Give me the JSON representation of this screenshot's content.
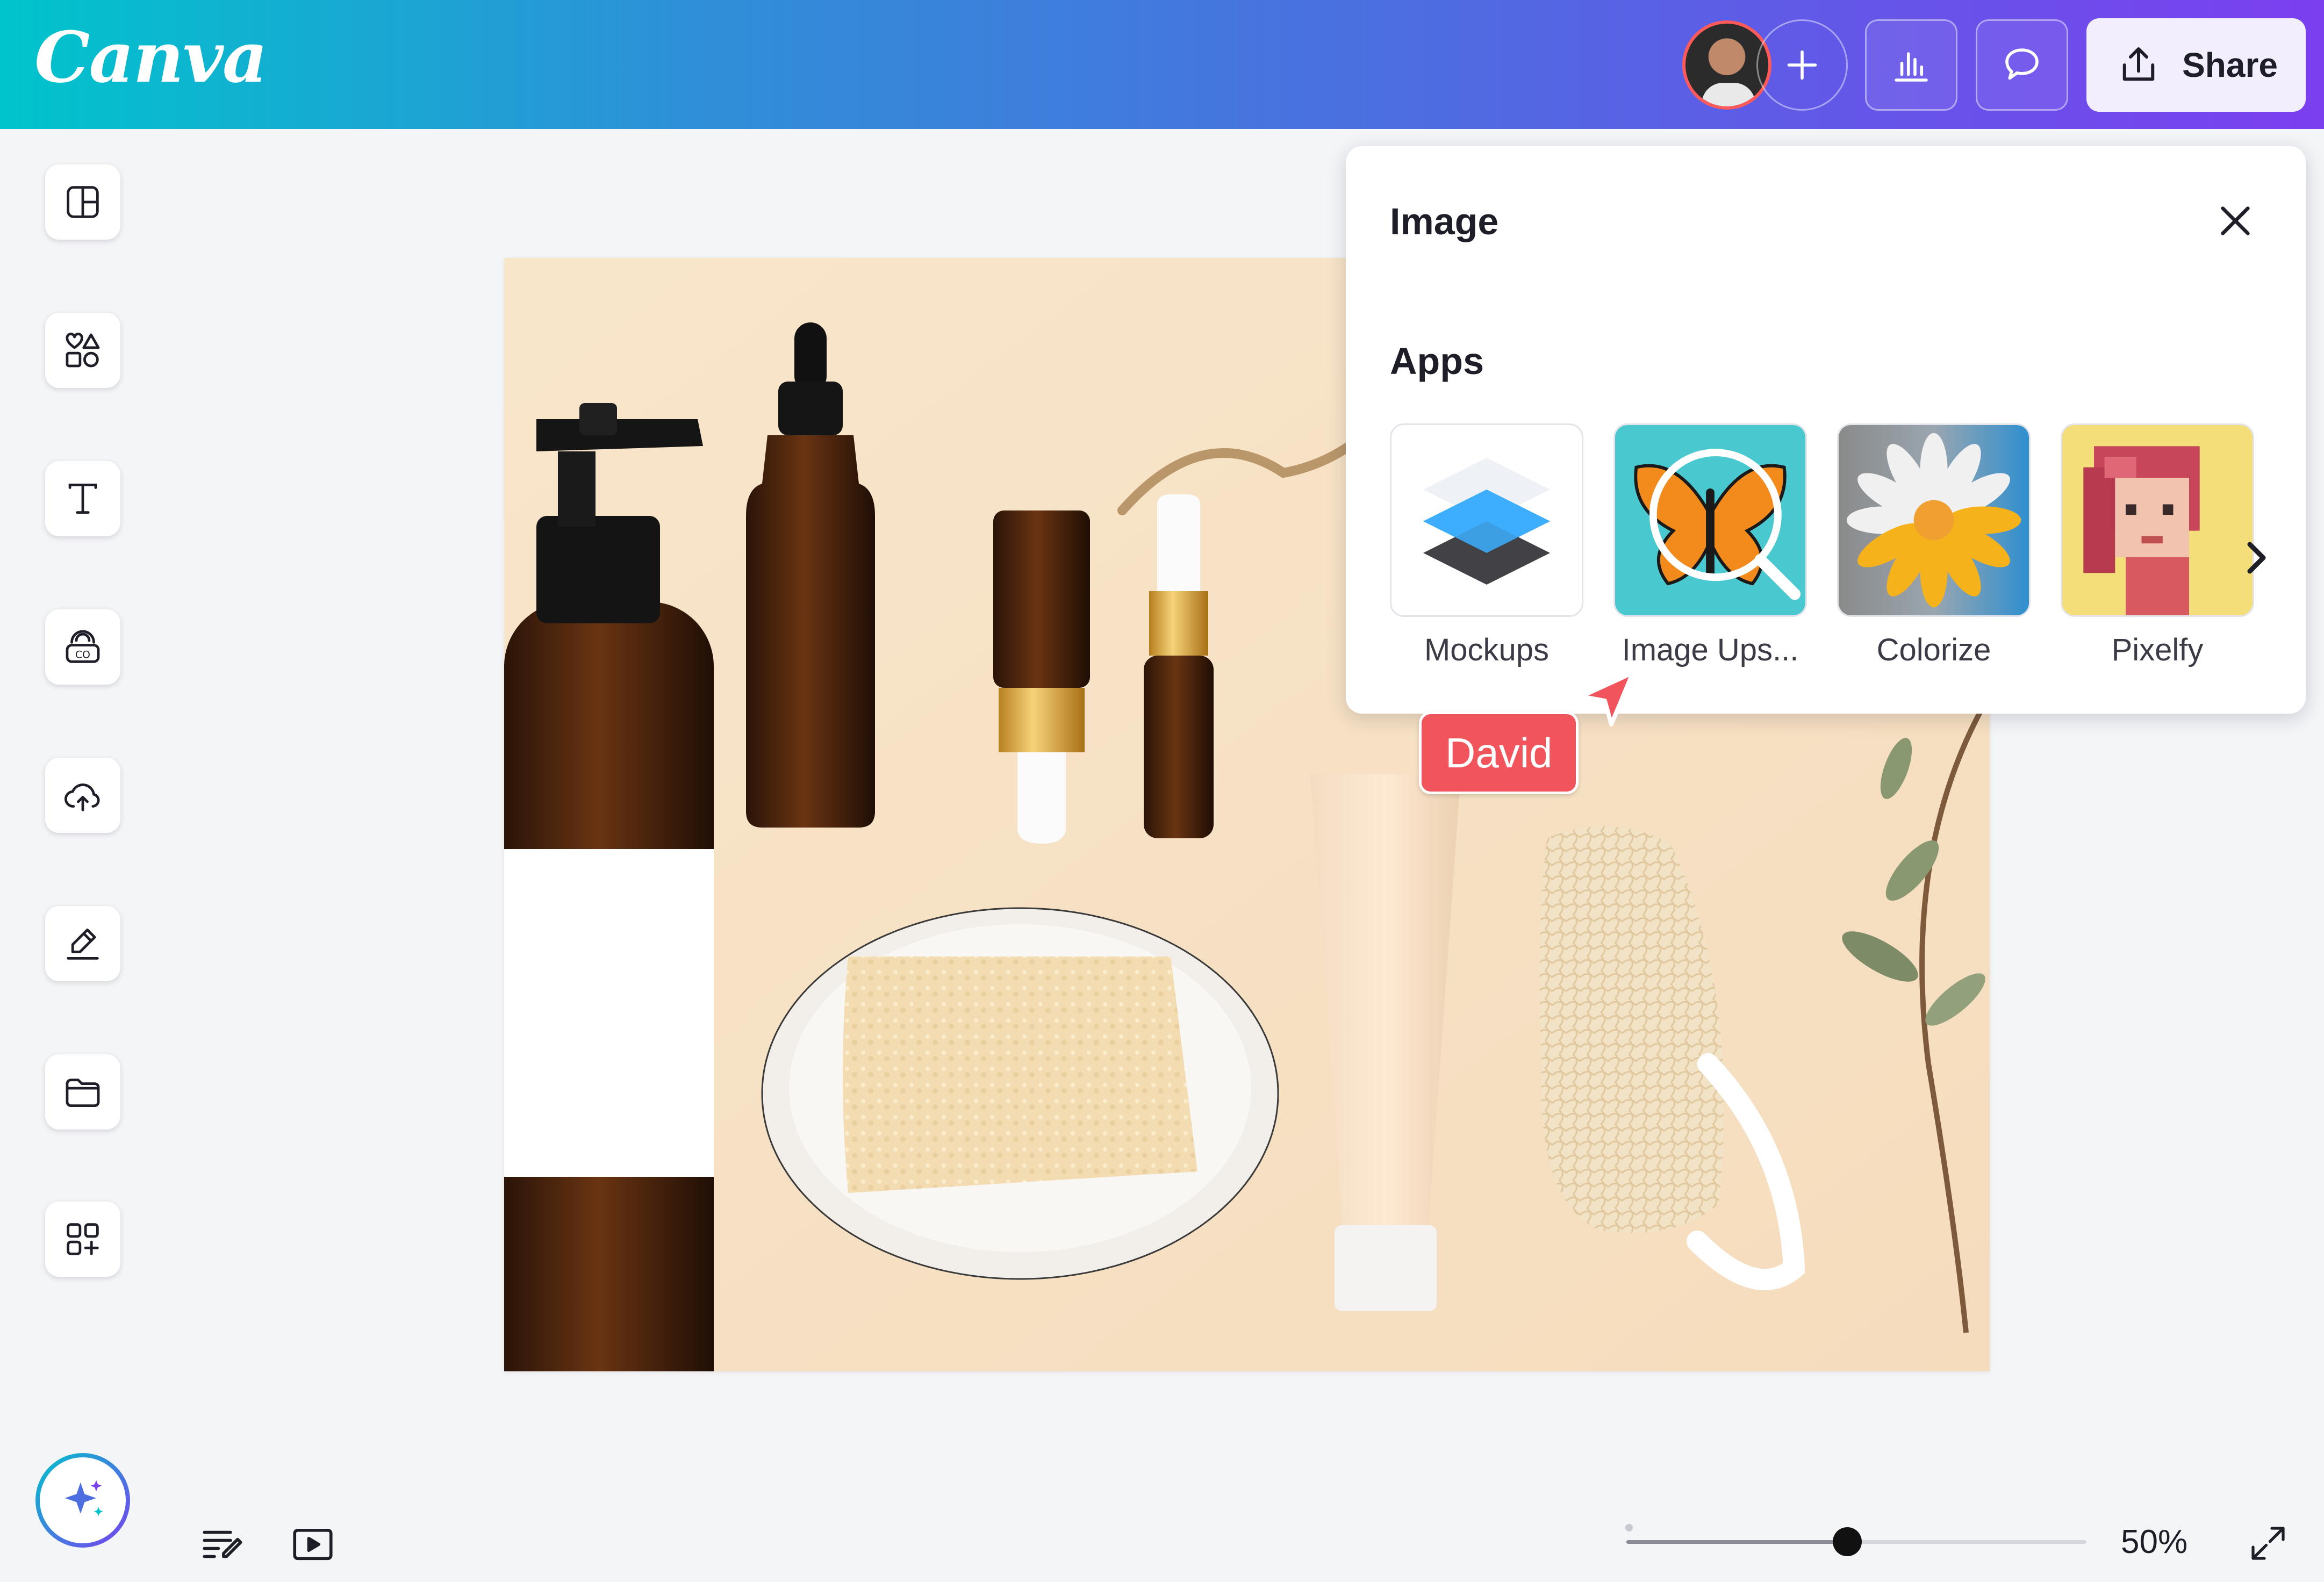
{
  "app": {
    "logo": "Canva"
  },
  "header": {
    "share_label": "Share",
    "buttons": [
      "add-people",
      "insights",
      "comments"
    ]
  },
  "sidebar": {
    "tools": [
      "design-templates",
      "elements",
      "text",
      "brand",
      "uploads",
      "draw",
      "projects",
      "apps"
    ],
    "magic_label": "Magic"
  },
  "panel": {
    "title": "Image",
    "section": "Apps",
    "apps": [
      {
        "label": "Mockups"
      },
      {
        "label": "Image Ups..."
      },
      {
        "label": "Colorize"
      },
      {
        "label": "Pixelfy"
      }
    ]
  },
  "collaborator": {
    "name": "David",
    "color": "#f2545b"
  },
  "footer": {
    "zoom_label": "50%",
    "zoom_fraction": 0.5
  },
  "colors": {
    "brand_gradient": [
      "#00c4cc",
      "#7b3ff0"
    ],
    "cursor": "#f2545b"
  }
}
